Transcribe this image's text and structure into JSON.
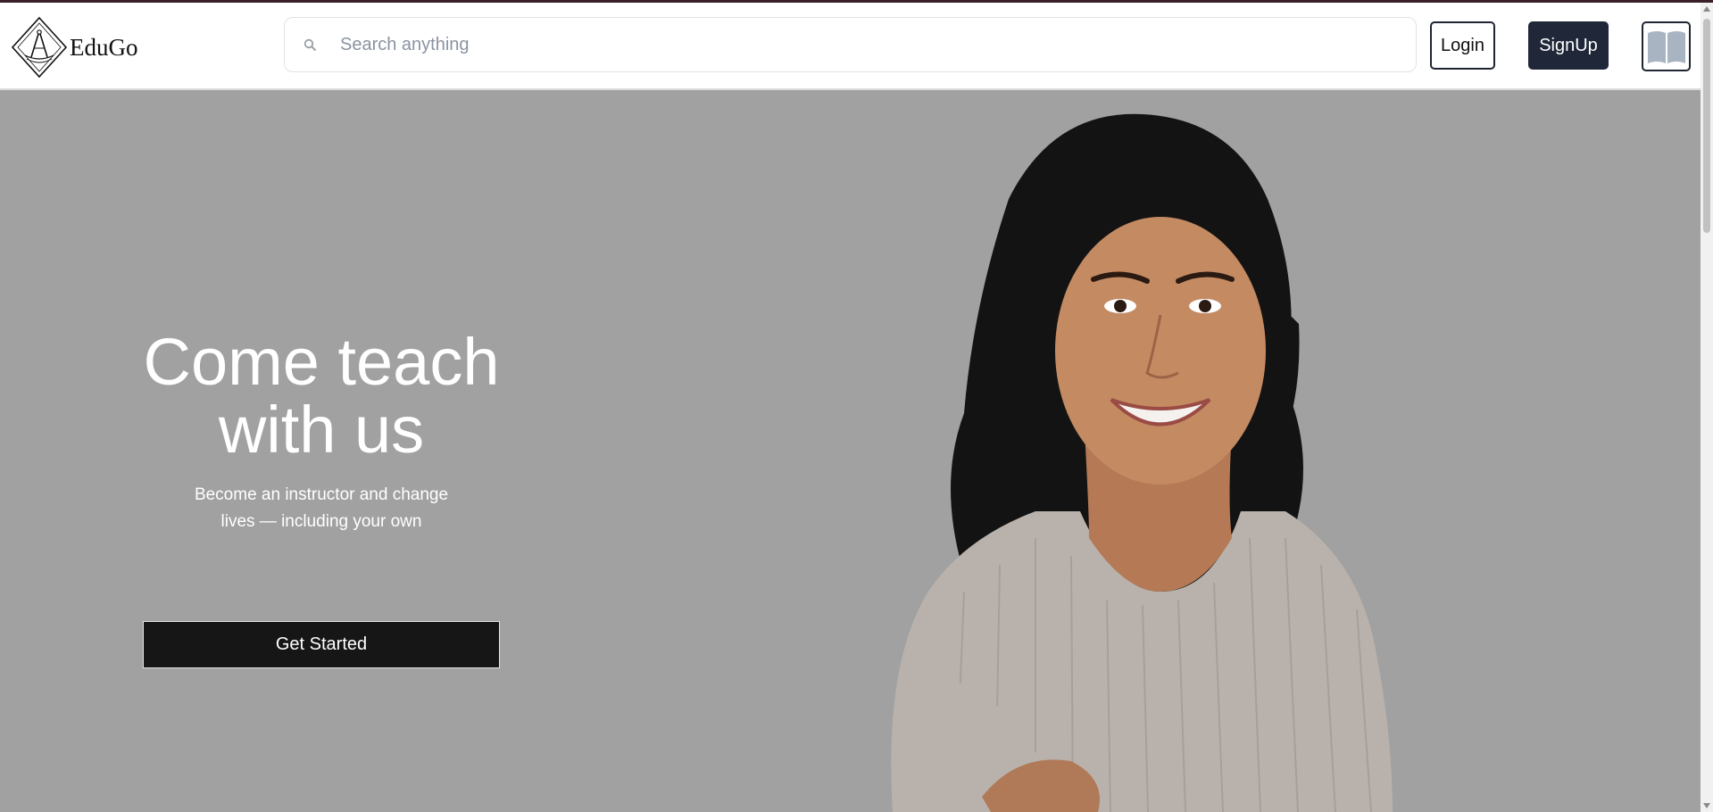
{
  "brand": {
    "name": "EduGo"
  },
  "header": {
    "search_placeholder": "Search anything",
    "login_label": "Login",
    "signup_label": "SignUp",
    "book_icon": "open-book-icon"
  },
  "hero": {
    "title": "Come teach with us",
    "subtitle": "Become an instructor and change lives — including your own",
    "cta_label": "Get Started",
    "image": "smiling-woman-portrait"
  },
  "colors": {
    "hero_bg": "#a1a1a1",
    "signup_bg": "#1f2738",
    "cta_bg": "#161616",
    "book_icon": "#a9b4c2"
  }
}
